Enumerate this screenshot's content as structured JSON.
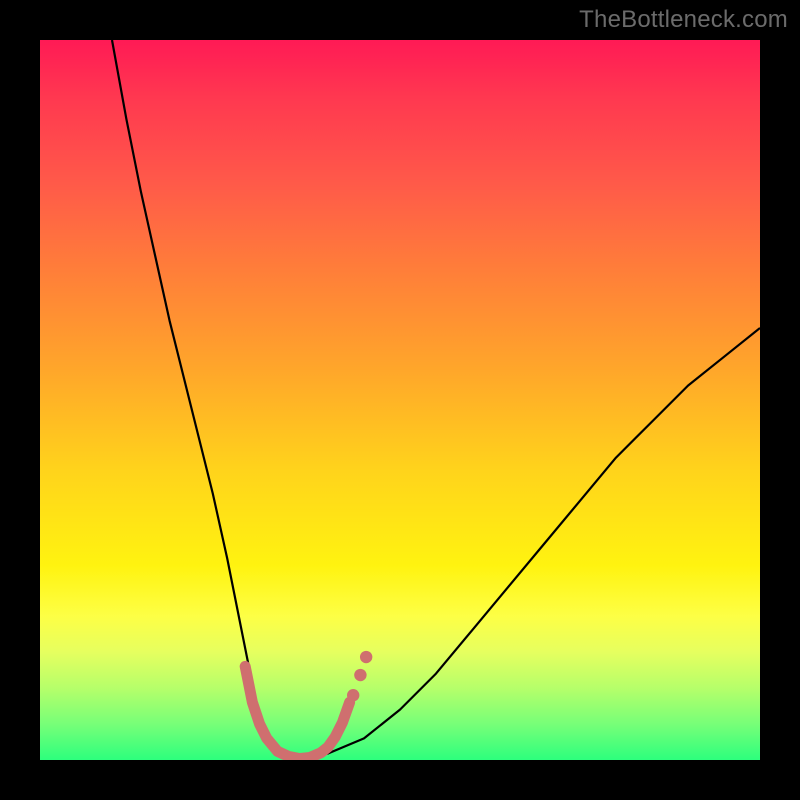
{
  "watermark": {
    "text": "TheBottleneck.com"
  },
  "chart_data": {
    "type": "line",
    "title": "",
    "xlabel": "",
    "ylabel": "",
    "xlim": [
      0,
      100
    ],
    "ylim": [
      0,
      100
    ],
    "series": [
      {
        "name": "bottleneck-curve",
        "color": "#000000",
        "width": 2.2,
        "x": [
          10,
          12,
          14,
          16,
          18,
          20,
          22,
          24,
          26,
          27,
          28,
          29,
          30,
          31,
          32,
          33,
          34,
          36,
          40,
          45,
          50,
          55,
          60,
          65,
          70,
          75,
          80,
          85,
          90,
          95,
          100
        ],
        "y": [
          100,
          89,
          79,
          70,
          61,
          53,
          45,
          37,
          28,
          23,
          18,
          13,
          8,
          5,
          3,
          1.5,
          0.6,
          0.2,
          0.9,
          3,
          7,
          12,
          18,
          24,
          30,
          36,
          42,
          47,
          52,
          56,
          60
        ]
      },
      {
        "name": "highlight-segment",
        "color": "#cf6f6f",
        "width": 11,
        "linecap": "round",
        "x": [
          28.5,
          29.5,
          30.5,
          31.5,
          33,
          34.5,
          36,
          37.5,
          39,
          40,
          41,
          42,
          43
        ],
        "y": [
          13,
          8,
          5,
          3,
          1.2,
          0.5,
          0.2,
          0.35,
          1.0,
          1.8,
          3.2,
          5.2,
          8
        ]
      }
    ],
    "markers": [
      {
        "name": "highlight-dot-1",
        "x": 43.5,
        "y": 9.0,
        "r": 6.2,
        "color": "#cf6f6f"
      },
      {
        "name": "highlight-dot-2",
        "x": 44.5,
        "y": 11.8,
        "r": 6.2,
        "color": "#cf6f6f"
      },
      {
        "name": "highlight-dot-3",
        "x": 45.3,
        "y": 14.3,
        "r": 6.2,
        "color": "#cf6f6f"
      }
    ]
  }
}
